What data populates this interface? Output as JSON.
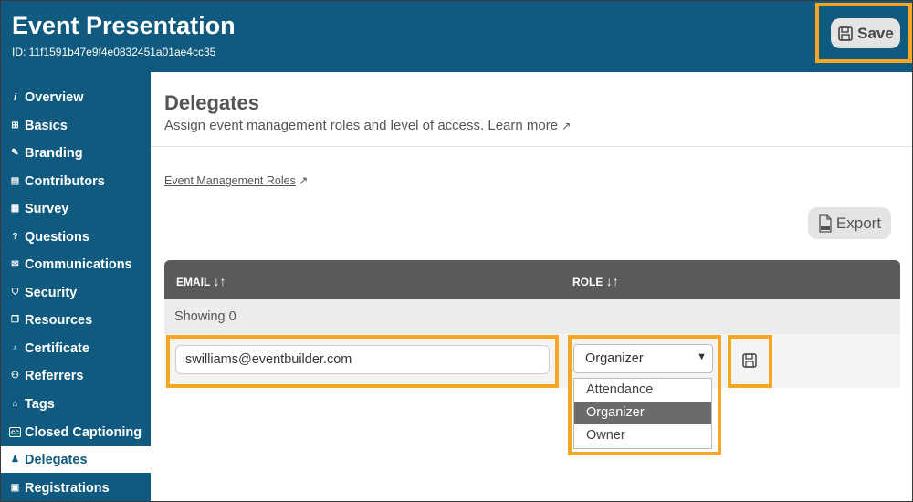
{
  "header": {
    "title": "Event Presentation",
    "event_id": "ID: 11f1591b47e9f4e0832451a01ae4cc35",
    "save_label": "Save"
  },
  "sidebar": {
    "items": [
      {
        "label": "Overview",
        "icon": "info-icon",
        "active": false
      },
      {
        "label": "Basics",
        "icon": "signpost-icon",
        "active": false
      },
      {
        "label": "Branding",
        "icon": "pen-icon",
        "active": false
      },
      {
        "label": "Contributors",
        "icon": "id-card-icon",
        "active": false
      },
      {
        "label": "Survey",
        "icon": "clipboard-icon",
        "active": false
      },
      {
        "label": "Questions",
        "icon": "question-icon",
        "active": false
      },
      {
        "label": "Communications",
        "icon": "envelope-icon",
        "active": false
      },
      {
        "label": "Security",
        "icon": "shield-icon",
        "active": false
      },
      {
        "label": "Resources",
        "icon": "copy-icon",
        "active": false
      },
      {
        "label": "Certificate",
        "icon": "award-icon",
        "active": false
      },
      {
        "label": "Referrers",
        "icon": "users-icon",
        "active": false
      },
      {
        "label": "Tags",
        "icon": "tag-icon",
        "active": false
      },
      {
        "label": "Closed Captioning",
        "icon": "cc-icon",
        "active": false
      },
      {
        "label": "Delegates",
        "icon": "person-icon",
        "active": true
      },
      {
        "label": "Registrations",
        "icon": "form-icon",
        "active": false
      }
    ]
  },
  "main": {
    "title": "Delegates",
    "description": "Assign event management roles and level of access.",
    "learn_more": "Learn more",
    "roles_link": "Event Management Roles",
    "export_label": "Export",
    "export_icon": "xlsx-file-icon"
  },
  "table": {
    "columns": [
      {
        "label": "EMAIL",
        "sort_icon": "sort-icon"
      },
      {
        "label": "ROLE",
        "sort_icon": "sort-icon"
      }
    ],
    "showing_text": "Showing 0"
  },
  "new_row": {
    "email_value": "swilliams@eventbuilder.com",
    "role_selected": "Organizer",
    "role_options": [
      "Attendance",
      "Organizer",
      "Owner"
    ]
  },
  "colors": {
    "brand": "#0f5a7e",
    "highlight": "#f5a623",
    "table_header": "#5a5a5a"
  }
}
